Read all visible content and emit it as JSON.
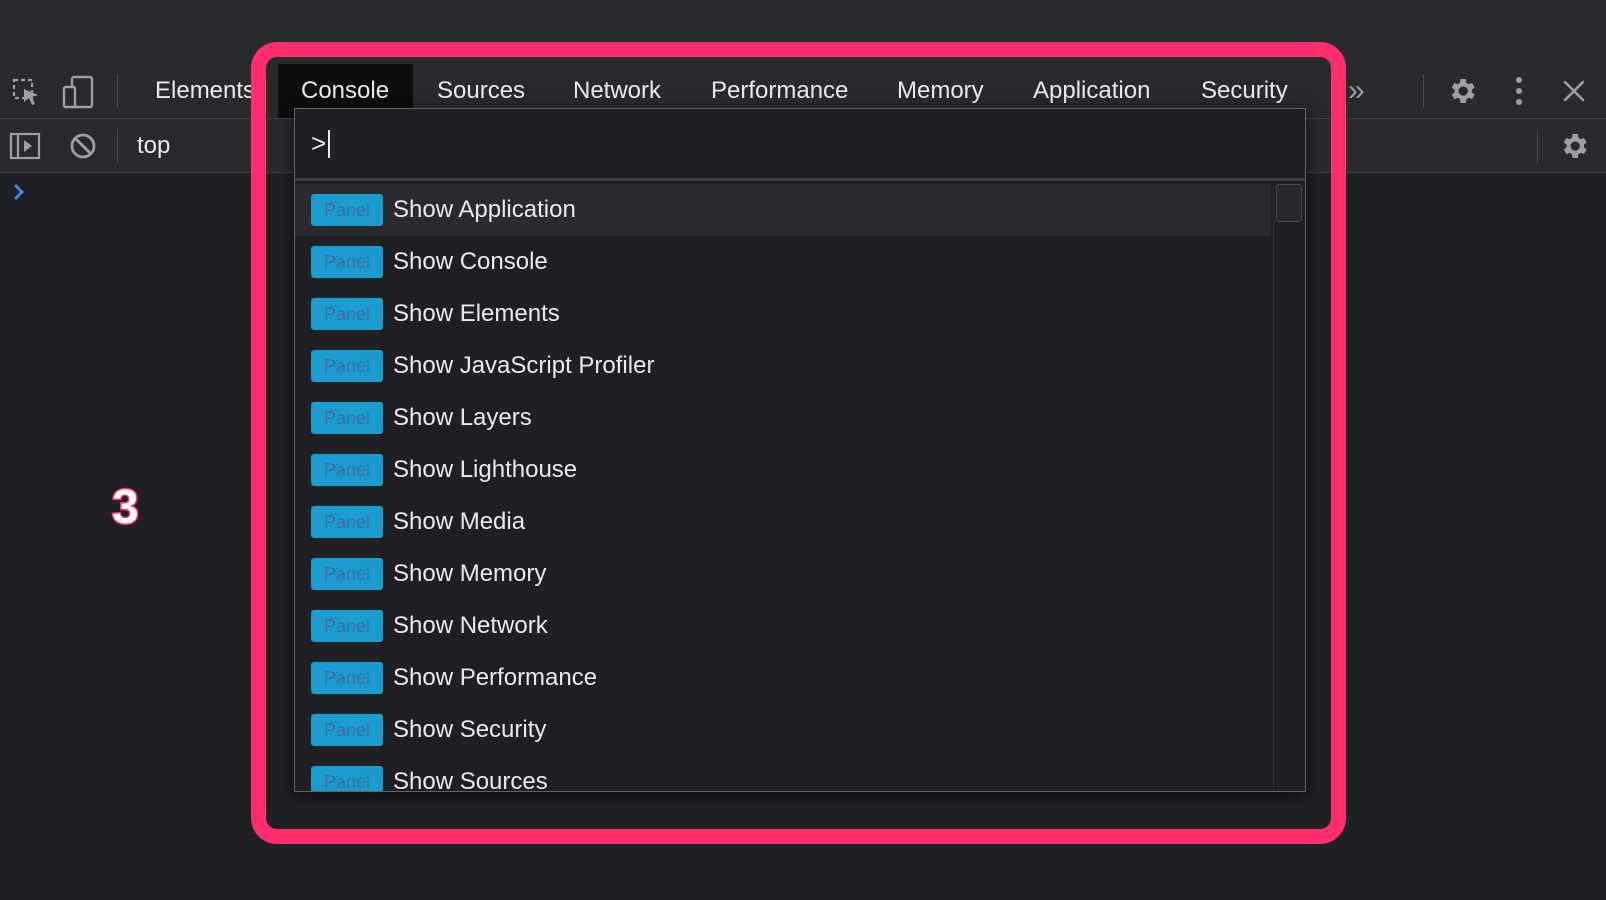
{
  "devtools": {
    "tabs": [
      {
        "label": "Elements",
        "active": false
      },
      {
        "label": "Console",
        "active": true
      },
      {
        "label": "Sources",
        "active": false
      },
      {
        "label": "Network",
        "active": false
      },
      {
        "label": "Performance",
        "active": false
      },
      {
        "label": "Memory",
        "active": false
      },
      {
        "label": "Application",
        "active": false
      },
      {
        "label": "Security",
        "active": false
      }
    ],
    "more_tabs_glyph": "»",
    "context_selector": "top"
  },
  "palette": {
    "input_value": ">",
    "badge_label": "Panel",
    "items": [
      {
        "label": "Show Application"
      },
      {
        "label": "Show Console"
      },
      {
        "label": "Show Elements"
      },
      {
        "label": "Show JavaScript Profiler"
      },
      {
        "label": "Show Layers"
      },
      {
        "label": "Show Lighthouse"
      },
      {
        "label": "Show Media"
      },
      {
        "label": "Show Memory"
      },
      {
        "label": "Show Network"
      },
      {
        "label": "Show Performance"
      },
      {
        "label": "Show Security"
      },
      {
        "label": "Show Sources"
      }
    ]
  },
  "annotation": {
    "step_number": "3",
    "highlight_color": "#ff2d6b"
  },
  "icons": {
    "inspect": "inspect-element-icon",
    "device": "device-toolbar-icon",
    "settings": "gear-icon",
    "menu": "kebab-menu-icon",
    "close": "close-icon",
    "sidebar": "sidebar-toggle-icon",
    "clear": "clear-console-icon",
    "prompt": "chevron-right-icon"
  },
  "colors": {
    "badge": "#1a9cd0",
    "background": "#202124",
    "toolbar": "#292a2d",
    "prompt": "#4285f4"
  }
}
